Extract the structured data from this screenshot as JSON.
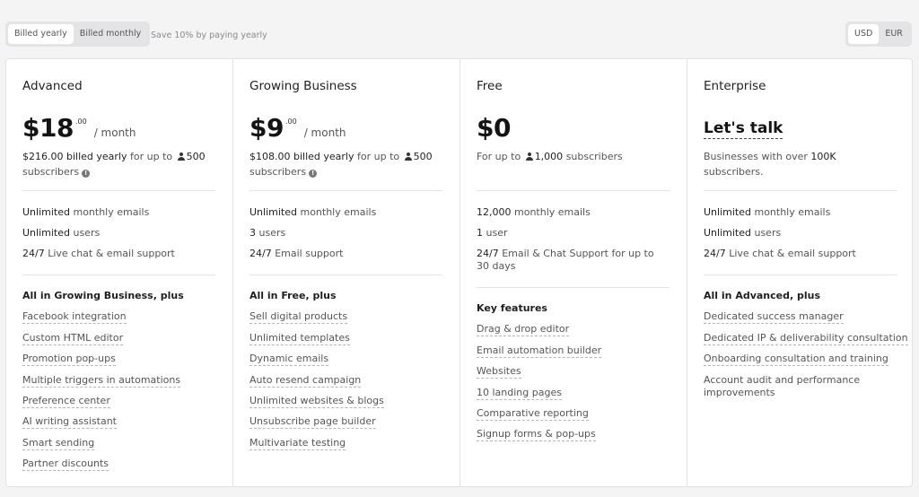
{
  "billing": {
    "yearly": "Billed yearly",
    "monthly": "Billed monthly",
    "note": "Save 10% by paying yearly"
  },
  "currency": {
    "usd": "USD",
    "eur": "EUR"
  },
  "plans": [
    {
      "name": "Advanced",
      "price": "$18",
      "cents": ".00",
      "per": "/ month",
      "desc_bold": "$216.00 billed yearly",
      "desc_mid": "for up to",
      "desc_count": "500",
      "desc_tail": "subscribers",
      "features": [
        {
          "bold": "Unlimited",
          "text": "monthly emails"
        },
        {
          "bold": "Unlimited",
          "text": "users"
        },
        {
          "bold": "24/7",
          "text": "Live chat & email support"
        }
      ],
      "section": "All in Growing Business, plus",
      "items": [
        "Facebook integration",
        "Custom HTML editor",
        "Promotion pop-ups",
        "Multiple triggers in automations",
        "Preference center",
        "AI writing assistant",
        "Smart sending",
        "Partner discounts"
      ]
    },
    {
      "name": "Growing Business",
      "price": "$9",
      "cents": ".00",
      "per": "/ month",
      "desc_bold": "$108.00 billed yearly",
      "desc_mid": "for up to",
      "desc_count": "500",
      "desc_tail": "subscribers",
      "features": [
        {
          "bold": "Unlimited",
          "text": "monthly emails"
        },
        {
          "bold": "3",
          "text": "users"
        },
        {
          "bold": "24/7",
          "text": "Email support"
        }
      ],
      "section": "All in Free, plus",
      "items": [
        "Sell digital products",
        "Unlimited templates",
        "Dynamic emails",
        "Auto resend campaign",
        "Unlimited websites & blogs",
        "Unsubscribe page builder",
        "Multivariate testing"
      ]
    },
    {
      "name": "Free",
      "price": "$0",
      "desc_mid": "For up to",
      "desc_count": "1,000",
      "desc_tail": "subscribers",
      "features": [
        {
          "bold": "12,000",
          "text": "monthly emails"
        },
        {
          "bold": "1",
          "text": "user"
        },
        {
          "bold": "24/7",
          "text": "Email & Chat Support for up to 30 days"
        }
      ],
      "section": "Key features",
      "items": [
        "Drag & drop editor",
        "Email automation builder",
        "Websites",
        "10 landing pages",
        "Comparative reporting",
        "Signup forms & pop-ups"
      ]
    },
    {
      "name": "Enterprise",
      "cta": "Let's talk",
      "desc_pre": "Businesses with over",
      "desc_count": "100K",
      "desc_tail": "subscribers.",
      "features": [
        {
          "bold": "Unlimited",
          "text": "monthly emails"
        },
        {
          "bold": "Unlimited",
          "text": "users"
        },
        {
          "bold": "24/7",
          "text": "Live chat & email support"
        }
      ],
      "section": "All in Advanced, plus",
      "items": [
        "Dedicated success manager",
        "Dedicated IP & deliverability consultation",
        "Onboarding consultation and training",
        "Account audit and performance improvements"
      ]
    }
  ]
}
